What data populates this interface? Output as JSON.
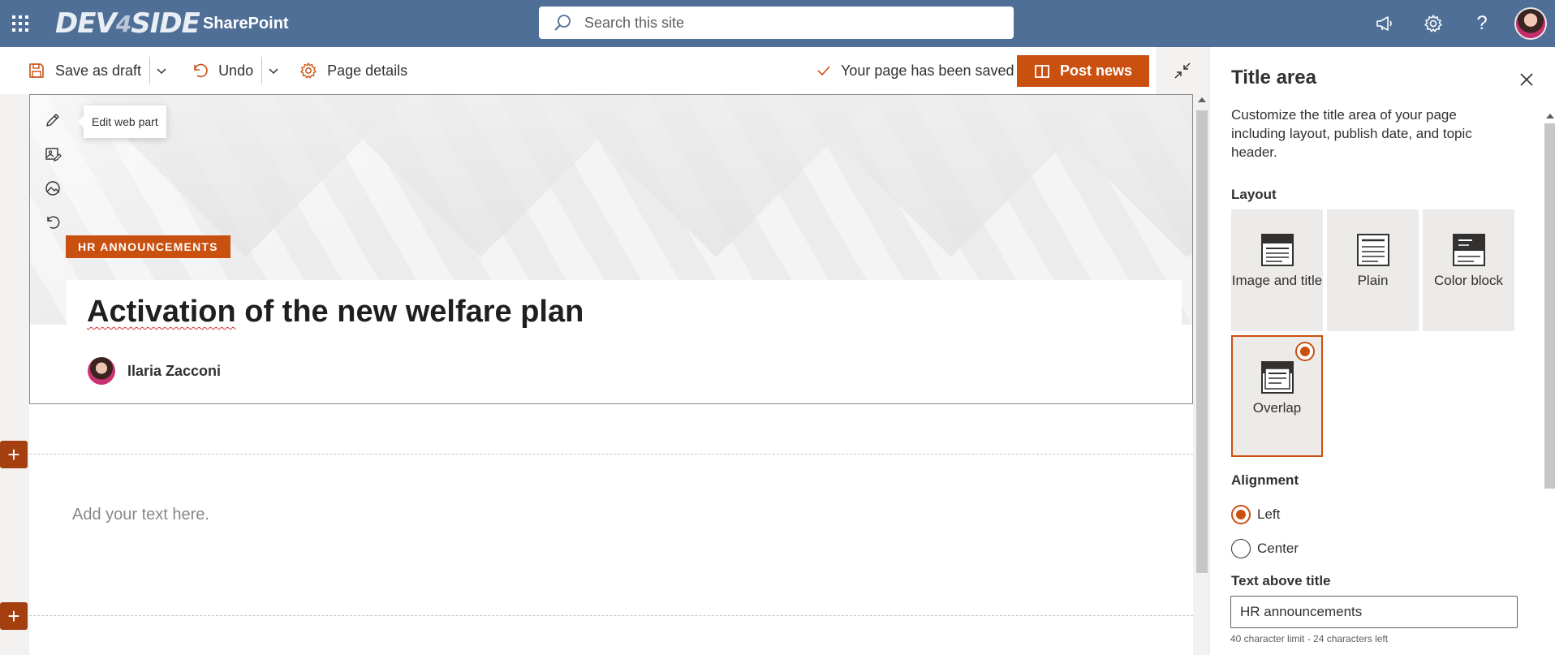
{
  "suite_bar": {
    "logo_text": "DEV",
    "logo_four": "4",
    "logo_tail": "SIDE",
    "app_name": "SharePoint",
    "search_placeholder": "Search this site",
    "icons": [
      "waffle-icon",
      "megaphone-icon",
      "gear-icon",
      "help-icon",
      "avatar"
    ],
    "help_label": "?"
  },
  "command_bar": {
    "save_label": "Save as draft",
    "undo_label": "Undo",
    "details_label": "Page details",
    "saved_status": "Your page has been saved",
    "post_label": "Post news"
  },
  "title_region": {
    "tooltip": "Edit web part",
    "topic_header": "HR ANNOUNCEMENTS",
    "title_word1": "Activation",
    "title_rest": " of the new welfare plan",
    "author_name": "Ilaria Zacconi"
  },
  "canvas": {
    "text_placeholder": "Add your text here.",
    "add_symbol": "+"
  },
  "property_pane": {
    "title": "Title area",
    "description": "Customize the title area of your page including layout, publish date, and topic header.",
    "layout_label": "Layout",
    "layouts": [
      {
        "label": "Image and title",
        "selected": false
      },
      {
        "label": "Plain",
        "selected": false
      },
      {
        "label": "Color block",
        "selected": false
      },
      {
        "label": "Overlap",
        "selected": true
      }
    ],
    "alignment_label": "Alignment",
    "alignment_options": [
      {
        "label": "Left",
        "checked": true
      },
      {
        "label": "Center",
        "checked": false
      }
    ],
    "text_above_title_label": "Text above title",
    "text_above_title_value": "HR announcements",
    "char_note": "40 character limit - 24 characters left"
  },
  "colors": {
    "suite_bar": "#4f6f96",
    "accent": "#ca5010",
    "add_section": "#a4400f"
  }
}
